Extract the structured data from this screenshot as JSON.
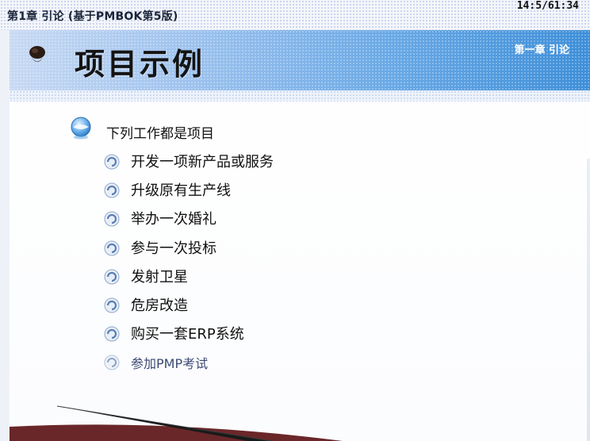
{
  "window": {
    "doc_title": "第1章 引论 (基于PMBOK第5版)",
    "timer": "14:5/61:34"
  },
  "slide": {
    "title": "项目示例",
    "chapter_label": "第一章 引论",
    "main_point": "下列工作都是项目",
    "items": [
      "开发一项新产品或服务",
      "升级原有生产线",
      "举办一次婚礼",
      "参与一次投标",
      "发射卫星",
      "危房改造",
      "购买一套ERP系统",
      "参加PMP考试"
    ]
  },
  "colors": {
    "band_start": "#c7d9f3",
    "band_end": "#3d8ed8",
    "bullet_blue": "#4d9fe2",
    "text": "#111111",
    "dim_text": "#3c4a73"
  }
}
